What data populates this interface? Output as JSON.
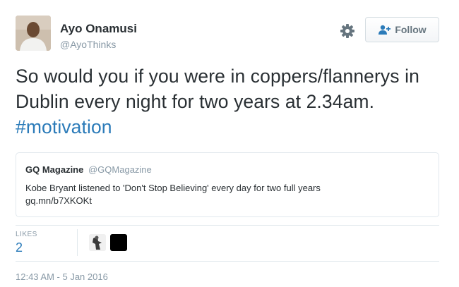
{
  "author": {
    "name": "Ayo Onamusi",
    "handle": "@AyoThinks"
  },
  "header": {
    "follow_label": "Follow",
    "settings_icon": "gear-icon",
    "follow_icon": "add-user-icon"
  },
  "tweet": {
    "text": "So would you if you were in coppers/flannerys in Dublin every night for two years at 2.34am.",
    "hashtag": "#motivation",
    "hashtag_color": "#2b7bb9"
  },
  "quote": {
    "name": "GQ Magazine",
    "handle": "@GQMagazine",
    "text_line1": "Kobe Bryant listened to 'Don't Stop Believing' every day for two full years",
    "text_line2": "gq.mn/b7XKOKt"
  },
  "stats": {
    "likes_label": "LIKES",
    "likes_count": "2"
  },
  "timestamp": "12:43 AM - 5 Jan 2016"
}
